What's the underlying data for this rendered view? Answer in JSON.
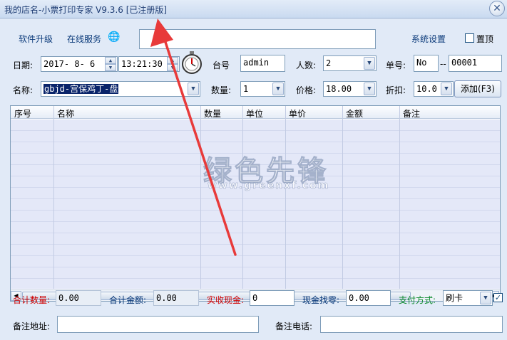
{
  "window": {
    "title": "我的店名-小票打印专家 V9.3.6 [已注册版]",
    "close_symbol": "✕"
  },
  "top": {
    "upgrade_label": "软件升级",
    "online_service_label": "在线服务",
    "globe_symbol": "🌐",
    "message_value": "",
    "settings_label": "系统设置",
    "pin_top_label": "置顶"
  },
  "row1": {
    "date_label": "日期:",
    "date_value": "2017- 8- 6",
    "time_value": "13:21:30",
    "table_label": "台号",
    "table_value": "admin",
    "people_label": "人数:",
    "people_value": "2",
    "order_label": "单号:",
    "order_prefix": "No",
    "order_dash": "--",
    "order_number": "00001"
  },
  "row2": {
    "name_label": "名称:",
    "name_value": "gbjd-宫保鸡丁-盘",
    "qty_label": "数量:",
    "qty_value": "1",
    "price_label": "价格:",
    "price_value": "18.00",
    "discount_label": "折扣:",
    "discount_value": "10.0",
    "add_button": "添加(F3)"
  },
  "grid": {
    "columns": [
      "序号",
      "名称",
      "数量",
      "单位",
      "单价",
      "金额",
      "备注"
    ],
    "rows": []
  },
  "summary": {
    "total_qty_label": "合计数量:",
    "total_qty_value": "0.00",
    "total_amount_label": "合计金额:",
    "total_amount_value": "0.00",
    "received_label": "实收现金:",
    "received_value": "0",
    "change_label": "现金找零:",
    "change_value": "0.00",
    "payment_label": "支付方式:",
    "payment_value": "刷卡"
  },
  "footer": {
    "address_label": "备注地址:",
    "address_value": "",
    "phone_label": "备注电话:",
    "phone_value": ""
  },
  "watermark": {
    "main": "绿色先锋",
    "url": "www.greenxf.com"
  },
  "colors": {
    "annotation_arrow": "#e83a3a",
    "red_label": "#d00000",
    "green_label": "#0a8a2a"
  }
}
